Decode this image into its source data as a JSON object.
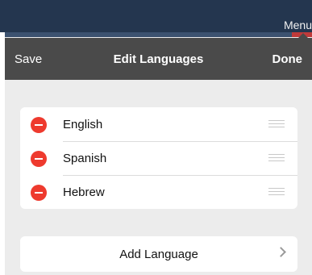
{
  "topbar": {
    "menu_label": "Menu"
  },
  "nav": {
    "save_label": "Save",
    "title": "Edit Languages",
    "done_label": "Done"
  },
  "languages": [
    {
      "label": "English"
    },
    {
      "label": "Spanish"
    },
    {
      "label": "Hebrew"
    }
  ],
  "add_language": {
    "label": "Add Language"
  },
  "colors": {
    "delete": "#ee3a2e",
    "nav_background": "#4a4a4a",
    "top_strip": "#24364f"
  }
}
